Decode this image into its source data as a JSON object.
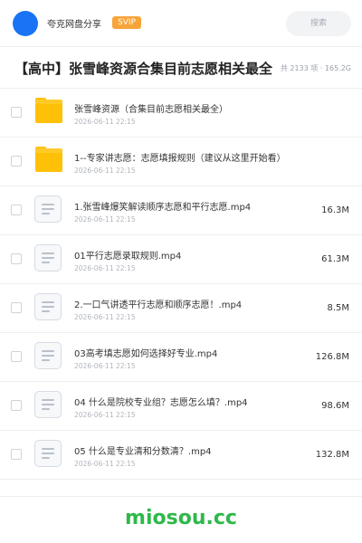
{
  "header": {
    "app_title": "夸克网盘分享",
    "svip_badge": "SVIP",
    "search_placeholder": "搜索"
  },
  "folder": {
    "title": "【高中】张雪峰资源合集目前志愿相关最全",
    "stats": "共 2133 项 · 165.2G"
  },
  "files": [
    {
      "type": "folder",
      "name": "张雪峰资源（合集目前志愿相关最全）",
      "date": "2026-06-11 22:15",
      "size": ""
    },
    {
      "type": "folder",
      "name": "1--专家讲志愿：志愿填报规则（建议从这里开始看）",
      "date": "2026-06-11 22:15",
      "size": ""
    },
    {
      "type": "file",
      "name": "1.张雪峰爆笑解读顺序志愿和平行志愿.mp4",
      "date": "2026-06-11 22:15",
      "size": "16.3M"
    },
    {
      "type": "file",
      "name": "01平行志愿录取规则.mp4",
      "date": "2026-06-11 22:15",
      "size": "61.3M"
    },
    {
      "type": "file",
      "name": "2.一口气讲透平行志愿和顺序志愿！.mp4",
      "date": "2026-06-11 22:15",
      "size": "8.5M"
    },
    {
      "type": "file",
      "name": "03高考填志愿如何选择好专业.mp4",
      "date": "2026-06-11 22:15",
      "size": "126.8M"
    },
    {
      "type": "file",
      "name": "04 什么是院校专业组？志愿怎么填？.mp4",
      "date": "2026-06-11 22:15",
      "size": "98.6M"
    },
    {
      "type": "file",
      "name": "05 什么是专业清和分数清？.mp4",
      "date": "2026-06-11 22:15",
      "size": "132.8M"
    }
  ],
  "footer": {
    "brand": "miosou.cc"
  },
  "colors": {
    "accent_blue": "#1a73f5",
    "svip_orange": "#f7a43a",
    "folder_yellow": "#ffc107",
    "brand_green": "#2fb84a"
  },
  "icons": {
    "folder": "folder-icon",
    "file": "video-file-icon"
  }
}
